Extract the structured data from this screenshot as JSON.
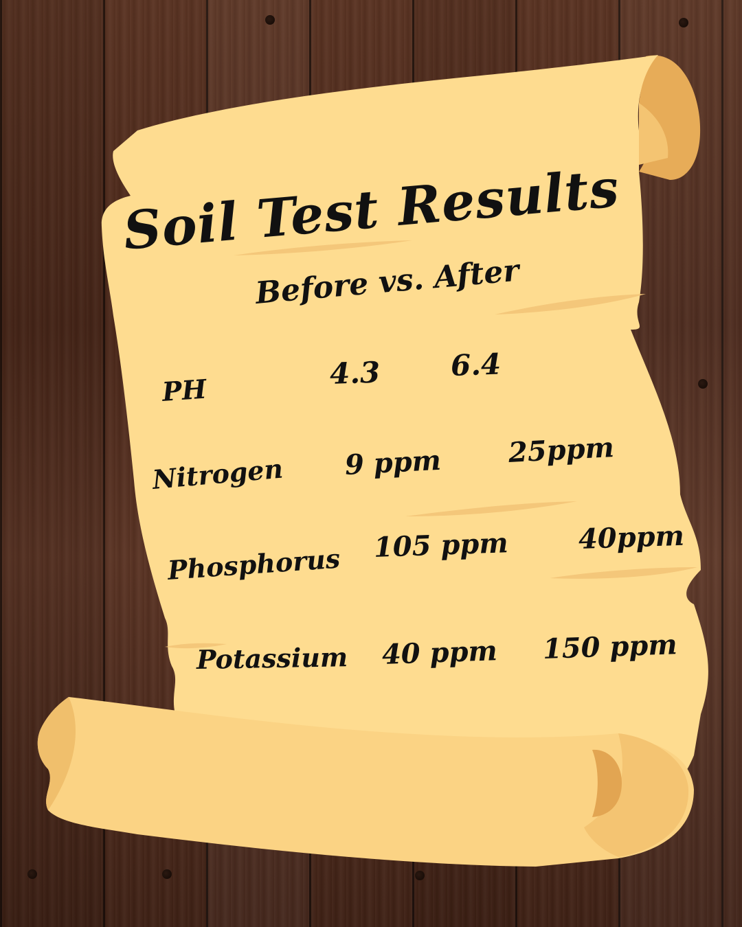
{
  "title": "Soil Test Results",
  "subtitle": "Before vs. After",
  "rows": [
    {
      "label": "PH",
      "before": "4.3",
      "after": "6.4"
    },
    {
      "label": "Nitrogen",
      "before": "9 ppm",
      "after": "25ppm"
    },
    {
      "label": "Phosphorus",
      "before": "105 ppm",
      "after": "40ppm"
    },
    {
      "label": "Potassium",
      "before": "40 ppm",
      "after": "150 ppm"
    }
  ],
  "colors": {
    "parchment": "#fedc90",
    "parchment_dark": "#f2c06a",
    "roll_shadow": "#e2a552",
    "wood": "#4a2719",
    "ink": "#111111"
  }
}
